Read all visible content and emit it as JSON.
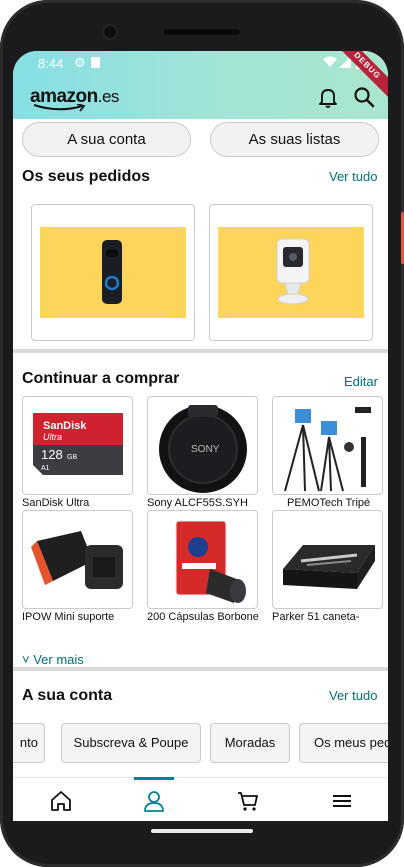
{
  "status_bar": {
    "time": "8:44",
    "debug_label": "DEBUG"
  },
  "header": {
    "logo_word": "amazon",
    "logo_tld": ".es",
    "icons": [
      "bell-icon",
      "search-icon"
    ]
  },
  "top_buttons": {
    "account": "A sua conta",
    "lists": "As suas listas"
  },
  "orders": {
    "title": "Os seus pedidos",
    "link": "Ver tudo",
    "items": [
      {
        "name": "video-doorbell"
      },
      {
        "name": "indoor-camera"
      }
    ]
  },
  "continue_shopping": {
    "title": "Continuar a comprar",
    "link": "Editar",
    "products": [
      {
        "label": "SanDisk Ultra"
      },
      {
        "label": "Sony ALCF55S.SYH"
      },
      {
        "label": "PEMOTech Tripé"
      },
      {
        "label": "IPOW Mini suporte"
      },
      {
        "label": "200 Cápsulas Borbone"
      },
      {
        "label": "Parker 51 caneta-"
      }
    ],
    "see_more": "Ver mais"
  },
  "account_section": {
    "title": "A sua conta",
    "link": "Ver tudo",
    "chips": [
      "nto",
      "Subscreva & Poupe",
      "Moradas",
      "Os meus pedi"
    ]
  },
  "tab_bar": {
    "tabs": [
      "home-icon",
      "account-icon",
      "cart-icon",
      "menu-icon"
    ],
    "active_tab": 1
  },
  "colors": {
    "header_gradient_start": "#86dfe3",
    "header_gradient_end": "#a9e6cf",
    "link": "#00707a",
    "tab_active": "#008296",
    "order_bg": "#fdd55b"
  }
}
